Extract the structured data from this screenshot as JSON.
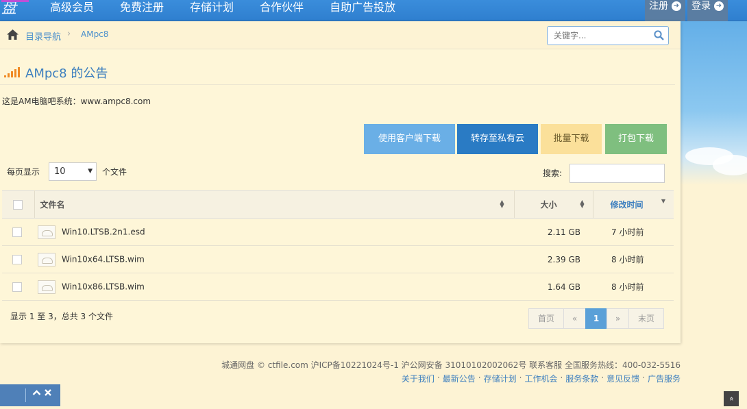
{
  "topnav": {
    "logo": "盘",
    "items": [
      "高级会员",
      "免费注册",
      "存储计划",
      "合作伙伴",
      "自助广告投放"
    ],
    "register": "注册",
    "login": "登录"
  },
  "breadcrumb": {
    "root": "目录导航",
    "current": "AMpc8",
    "search_placeholder": "关键字..."
  },
  "notice": {
    "title": "AMpc8 的公告",
    "text": "这是AM电脑吧系统：www.ampc8.com"
  },
  "actions": {
    "client_download": "使用客户端下载",
    "save_private": "转存至私有云",
    "batch_download": "批量下载",
    "pack_download": "打包下载"
  },
  "list_controls": {
    "per_page_label": "每页显示",
    "per_page_value": "10",
    "files_label": "个文件",
    "filter_label": "搜索:"
  },
  "table": {
    "columns": {
      "name": "文件名",
      "size": "大小",
      "modified": "修改时间"
    },
    "rows": [
      {
        "name": "Win10.LTSB.2n1.esd",
        "size": "2.11 GB",
        "modified": "7 小时前"
      },
      {
        "name": "Win10x64.LTSB.wim",
        "size": "2.39 GB",
        "modified": "8 小时前"
      },
      {
        "name": "Win10x86.LTSB.wim",
        "size": "1.64 GB",
        "modified": "8 小时前"
      }
    ]
  },
  "table_info": "显示 1 至 3，总共 3 个文件",
  "pager": {
    "first": "首页",
    "prev": "«",
    "page": "1",
    "next": "»",
    "last": "末页"
  },
  "footer": {
    "line1": "城通网盘 © ctfile.com  沪ICP备10221024号-1   沪公网安备 31010102002062号  联系客服  全国服务热线：400-032-5516",
    "links": [
      "关于我们",
      "最新公告",
      "存储计划",
      "工作机会",
      "服务条款",
      "意见反馈",
      "广告服务"
    ]
  },
  "colors": {
    "nav_bg": "#2f7fcf",
    "client_btn": "#6aafe6",
    "private_btn": "#2a7bc4",
    "batch_btn": "#fbe09a",
    "pack_btn": "#7fbf7f",
    "pager_active": "#5aa0d8"
  }
}
